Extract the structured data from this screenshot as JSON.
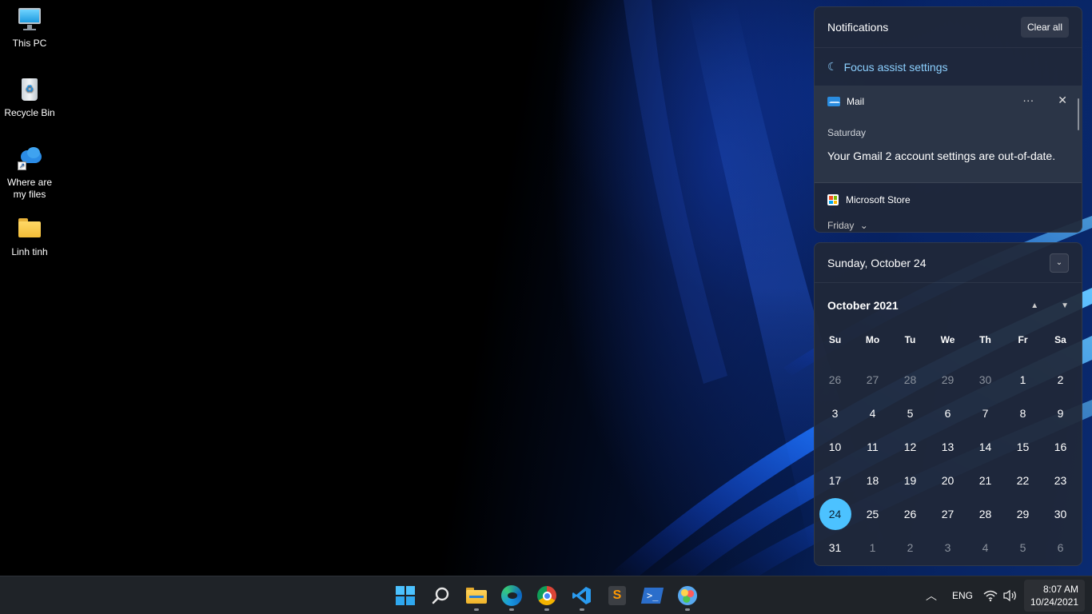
{
  "desktop": {
    "icons": [
      {
        "label": "This PC",
        "icon": "monitor-icon"
      },
      {
        "label": "Recycle Bin",
        "icon": "recycle-bin-icon"
      },
      {
        "label": "Where are my files",
        "icon": "onedrive-shortcut-icon"
      },
      {
        "label": "Linh tinh",
        "icon": "folder-icon"
      }
    ]
  },
  "notifications": {
    "title": "Notifications",
    "clear_all": "Clear all",
    "focus_assist": "Focus assist settings",
    "cards": [
      {
        "app": "Mail",
        "icon": "mail-icon",
        "day": "Saturday",
        "body": "Your Gmail 2 account settings are out-of-date.",
        "more": "···",
        "close": "✕"
      },
      {
        "app": "Microsoft Store",
        "icon": "store-icon",
        "day": "Friday"
      }
    ]
  },
  "calendar": {
    "date_header": "Sunday, October 24",
    "month_label": "October 2021",
    "weekdays": [
      "Su",
      "Mo",
      "Tu",
      "We",
      "Th",
      "Fr",
      "Sa"
    ],
    "weeks": [
      [
        "26",
        "27",
        "28",
        "29",
        "30",
        "1",
        "2"
      ],
      [
        "3",
        "4",
        "5",
        "6",
        "7",
        "8",
        "9"
      ],
      [
        "10",
        "11",
        "12",
        "13",
        "14",
        "15",
        "16"
      ],
      [
        "17",
        "18",
        "19",
        "20",
        "21",
        "22",
        "23"
      ],
      [
        "24",
        "25",
        "26",
        "27",
        "28",
        "29",
        "30"
      ],
      [
        "31",
        "1",
        "2",
        "3",
        "4",
        "5",
        "6"
      ]
    ],
    "today": "24",
    "accent": "#4cc2ff"
  },
  "taskbar": {
    "apps": [
      "start-icon",
      "search-icon",
      "file-explorer-icon",
      "edge-icon",
      "chrome-icon",
      "vscode-icon",
      "sublime-text-icon",
      "powershell-icon",
      "paint-icon"
    ],
    "tray": {
      "language": "ENG",
      "time": "8:07 AM",
      "date": "10/24/2021"
    }
  }
}
